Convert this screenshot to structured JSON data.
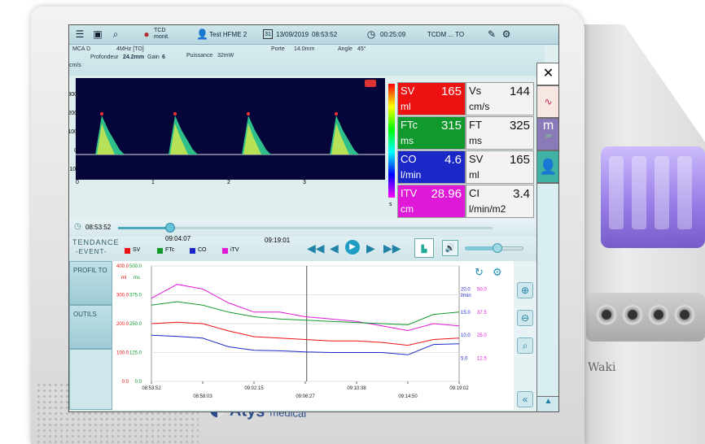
{
  "topbar": {
    "tcd_logo": "TCD\nmonit.",
    "patient": "Test HFME 2",
    "date": "13/09/2019",
    "time": "08:53:52",
    "timer": "00:25:09",
    "mode": "TCDM ... TO",
    "icons": [
      "menu-icon",
      "save-icon",
      "database-search-icon",
      "patient-icon",
      "calendar-icon",
      "stopwatch-icon",
      "report-icon",
      "gear-icon"
    ]
  },
  "info": {
    "channel": "MCA D",
    "probe": "4MHz [TO]",
    "depth_label": "Profondeur",
    "depth": "24.2mm",
    "gain_label": "Gain",
    "gain": "6",
    "power_label": "Puissance",
    "power": "32mW",
    "gate_label": "Porte",
    "gate": "14.0mm",
    "angle_label": "Angle",
    "angle": "45°",
    "scale_unit": "cm/s",
    "scale_ticks": [
      "300",
      "200",
      "100",
      "0",
      "-100"
    ],
    "time_ticks": [
      "0",
      "1",
      "2",
      "3"
    ],
    "s_label": "s"
  },
  "values": [
    {
      "label": "SV",
      "unit": "ml",
      "value": "165",
      "color": "#ee1111"
    },
    {
      "label": "FTc",
      "unit": "ms",
      "value": "315",
      "color": "#109a2e"
    },
    {
      "label": "CO",
      "unit": "l/min",
      "value": "4.6",
      "color": "#1a28c8"
    },
    {
      "label": "ITV",
      "unit": "cm",
      "value": "28.96",
      "color": "#e019d8"
    }
  ],
  "secondary_values": [
    {
      "label": "Vs",
      "unit": "cm/s",
      "value": "144"
    },
    {
      "label": "FT",
      "unit": "ms",
      "value": "325"
    },
    {
      "label": "SV",
      "unit": "ml",
      "value": "165"
    },
    {
      "label": "CI",
      "unit": "l/min/m2",
      "value": "3.4"
    }
  ],
  "playback": {
    "start_time": "08:53:52",
    "cursor_time": "09:04:07",
    "end_time": "09:19:01",
    "cursor_position": 0.42
  },
  "trend": {
    "title": "TENDANCE",
    "subtitle": "-EVENT-",
    "legend": [
      {
        "name": "SV",
        "color": "#ee1111"
      },
      {
        "name": "FTc",
        "color": "#109a2e"
      },
      {
        "name": "CO",
        "color": "#1a28c8"
      },
      {
        "name": "iTV",
        "color": "#e019d8"
      }
    ],
    "volume_level": 0.55
  },
  "sidemenu": {
    "profil": "PROFIL TO",
    "outils": "OUTILS"
  },
  "right_strip": {
    "close": "✕",
    "m_label": "m",
    "m_sub": "on"
  },
  "device": {
    "brand": "Atys",
    "brand_sub": "medical",
    "model": "Waki"
  },
  "chart_data": {
    "type": "line",
    "x": [
      "08:53:52",
      "08:58:03",
      "09:02:15",
      "09:06:27",
      "09:10:38",
      "09:14:50",
      "09:19:02"
    ],
    "left_axes": [
      {
        "unit": "ml",
        "color": "#ee1111",
        "ticks": [
          "400.0",
          "300.0",
          "200.0",
          "100.0",
          "0.0"
        ]
      },
      {
        "unit": "ms",
        "color": "#109a2e",
        "ticks": [
          "500.0",
          "375.0",
          "250.0",
          "125.0",
          "0.0"
        ]
      }
    ],
    "right_axes": [
      {
        "unit": "l/min",
        "color": "#1a28c8",
        "ticks": [
          "20.0",
          "15.0",
          "10.0",
          "5.0"
        ]
      },
      {
        "unit": "",
        "color": "#e019d8",
        "ticks": [
          "50.0",
          "37.5",
          "25.0",
          "12.5"
        ]
      }
    ],
    "series": [
      {
        "name": "iTV",
        "color": "#e019d8",
        "values": [
          36,
          42,
          40,
          34,
          30,
          30,
          28,
          27,
          26,
          24,
          22,
          25,
          24
        ]
      },
      {
        "name": "FTc",
        "color": "#109a2e",
        "values": [
          330,
          345,
          330,
          300,
          280,
          270,
          265,
          260,
          255,
          250,
          245,
          290,
          300
        ]
      },
      {
        "name": "SV",
        "color": "#ee1111",
        "values": [
          200,
          205,
          200,
          175,
          155,
          150,
          145,
          140,
          140,
          135,
          125,
          145,
          150
        ]
      },
      {
        "name": "CO",
        "color": "#1a28c8",
        "values": [
          8.0,
          7.8,
          7.5,
          6.0,
          5.4,
          5.3,
          5.1,
          5.0,
          5.0,
          5.0,
          4.6,
          6.4,
          6.5
        ]
      }
    ]
  }
}
